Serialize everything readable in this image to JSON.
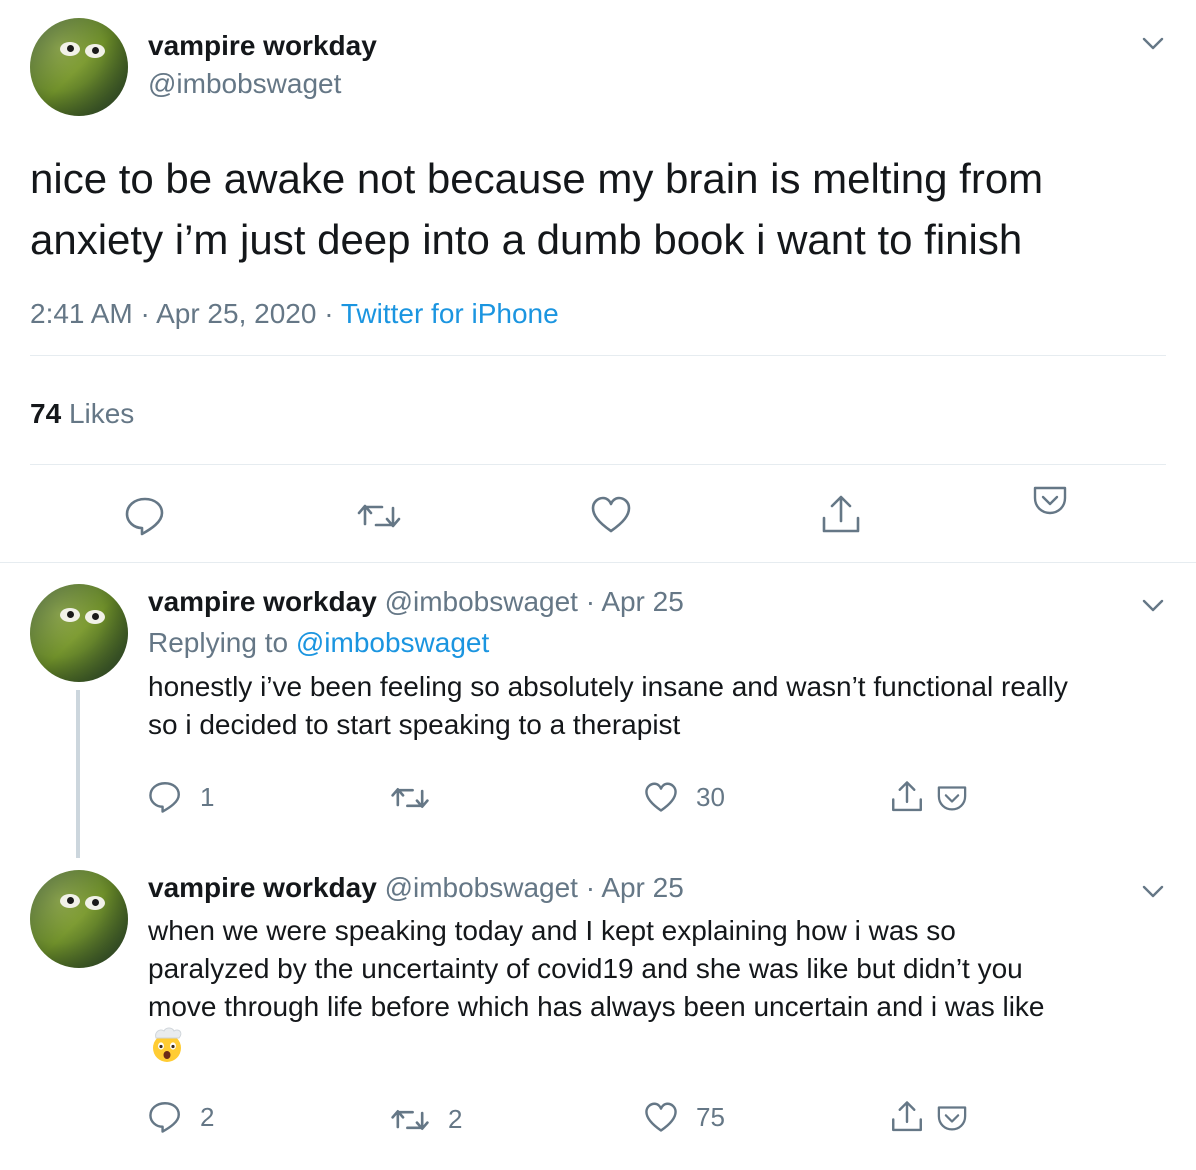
{
  "main_tweet": {
    "display_name": "vampire workday",
    "handle": "@imbobswaget",
    "text": "nice to be awake not because my brain is melting from anxiety i’m just deep into a dumb book i want to finish",
    "time": "2:41 AM",
    "date": "Apr 25, 2020",
    "source": "Twitter for iPhone",
    "likes_count": "74",
    "likes_label": "Likes",
    "separator": "·"
  },
  "reply1": {
    "display_name": "vampire workday",
    "handle": "@imbobswaget",
    "date": "Apr 25",
    "replying_prefix": "Replying to",
    "replying_to": "@imbobswaget",
    "line1": "honestly i’ve been feeling so absolutely insane and wasn’t functional really",
    "line2": "so i decided to start speaking to a therapist",
    "reply_count": "1",
    "retweet_count": "",
    "like_count": "30"
  },
  "reply2": {
    "display_name": "vampire workday",
    "handle": "@imbobswaget",
    "date": "Apr 25",
    "line1": "when we were speaking today and I kept explaining how i was so",
    "line2": "paralyzed by the uncertainty of covid19 and she was like but didn’t you",
    "line3": "move through life before which has always been uncertain and i was like",
    "emoji": "exploding-head-emoji",
    "reply_count": "2",
    "retweet_count": "2",
    "like_count": "75"
  },
  "colors": {
    "text": "#14171a",
    "secondary": "#657786",
    "link": "#1b95e0",
    "divider": "#e6ecf0"
  }
}
